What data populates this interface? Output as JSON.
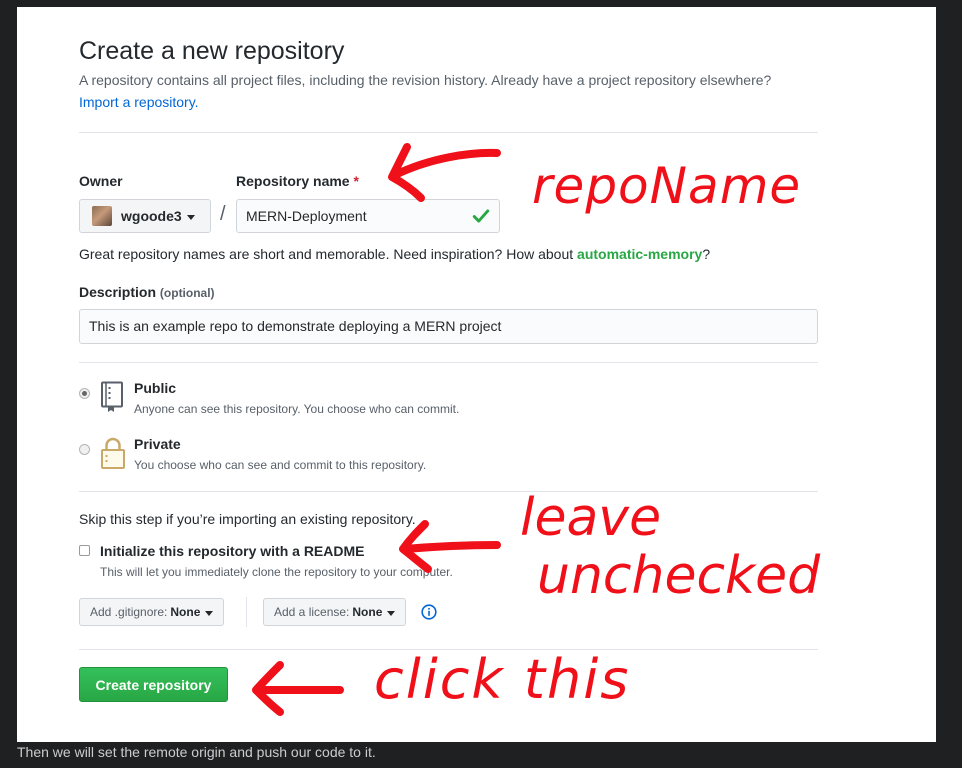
{
  "form": {
    "title": "Create a new repository",
    "subtitle": "A repository contains all project files, including the revision history. Already have a project repository elsewhere?",
    "import_link": "Import a repository.",
    "owner_label": "Owner",
    "owner_value": "wgoode3",
    "repo_label": "Repository name",
    "repo_required": "*",
    "repo_value": "MERN-Deployment",
    "slash": "/",
    "name_hint_prefix": "Great repository names are short and memorable. Need inspiration? How about ",
    "name_hint_suggestion": "automatic-memory",
    "name_hint_suffix": "?",
    "description_label": "Description",
    "description_optional": "(optional)",
    "description_value": "This is an example repo to demonstrate deploying a MERN project",
    "visibility": {
      "public_title": "Public",
      "public_desc": "Anyone can see this repository. You choose who can commit.",
      "private_title": "Private",
      "private_desc": "You choose who can see and commit to this repository.",
      "selected": "Public"
    },
    "skip_text": "Skip this step if you’re importing an existing repository.",
    "readme_title": "Initialize this repository with a README",
    "readme_desc": "This will let you immediately clone the repository to your computer.",
    "readme_checked": false,
    "gitignore_label": "Add .gitignore:",
    "gitignore_value": "None",
    "license_label": "Add a license:",
    "license_value": "None",
    "create_button": "Create repository"
  },
  "annotations": {
    "repo_name": "repoName",
    "leave": "leave",
    "unchecked": "unchecked",
    "click": "click this",
    "color": "#f0101a"
  },
  "caption": "Then we will set the remote origin and push our code to it.",
  "colors": {
    "link": "#0366d6",
    "success": "#28a745",
    "required": "#cb2431"
  }
}
